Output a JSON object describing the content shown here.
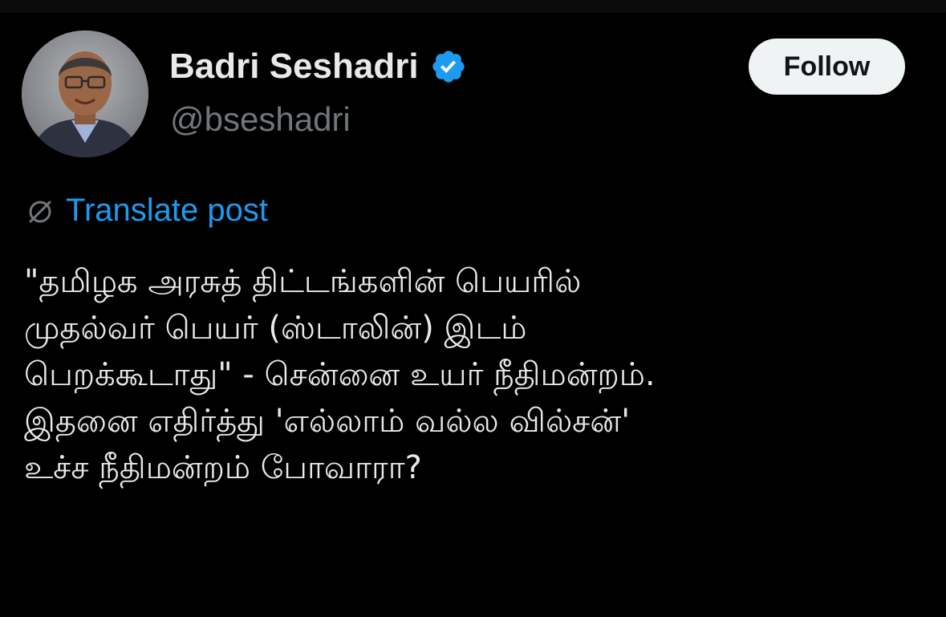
{
  "author": {
    "display_name": "Badri Seshadri",
    "handle": "@bseshadri",
    "verified": true,
    "avatar_icon": "profile-photo"
  },
  "actions": {
    "follow_label": "Follow"
  },
  "translate": {
    "label": "Translate post",
    "icon": "globe-icon"
  },
  "post": {
    "lines": [
      "\"தமிழக அரசுத் திட்டங்களின் பெயரில்",
      "முதல்வர் பெயர் (ஸ்டாலின்) இடம்",
      "பெறக்கூடாது\" - சென்னை உயர் நீதிமன்றம்.",
      "இதனை எதிர்த்து 'எல்லாம் வல்ல வில்சன்'",
      "உச்ச நீதிமன்றம் போவாரா?"
    ]
  },
  "colors": {
    "background": "#000000",
    "text_primary": "#e7e9ea",
    "text_secondary": "#71767b",
    "accent": "#1d9bf0",
    "follow_bg": "#eff3f4"
  }
}
